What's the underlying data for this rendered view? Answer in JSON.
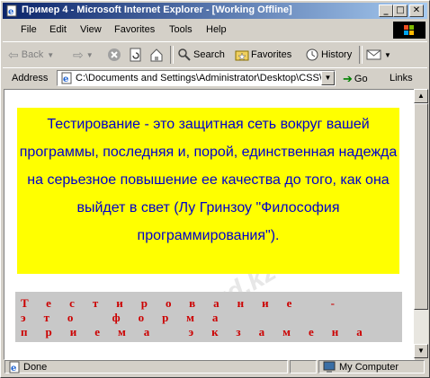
{
  "window": {
    "title": "Пример 4 - Microsoft Internet Explorer - [Working Offline]"
  },
  "menu": {
    "items": [
      "File",
      "Edit",
      "View",
      "Favorites",
      "Tools",
      "Help"
    ]
  },
  "toolbar": {
    "back": "Back",
    "search": "Search",
    "favorites": "Favorites",
    "history": "History"
  },
  "address": {
    "label": "Address",
    "value": "C:\\Documents and Settings\\Administrator\\Desktop\\CSS\\У",
    "go": "Go",
    "links": "Links"
  },
  "content": {
    "paragraph1": "Тестирование - это защитная сеть вокруг вашей программы, последняя и, порой, единственная надежда на серьезное повышение ее качества до того, как она выйдет в свет (Лу Гринзоу \"Философия программирования\").",
    "paragraph2": "Тестирование - это форма приема экзамена",
    "colors": {
      "para1_bg": "#ffff00",
      "para1_text": "#0000cc",
      "para2_bg": "#c8c8c8",
      "para2_text": "#cc0000"
    }
  },
  "status": {
    "text": "Done",
    "zone": "My Computer"
  },
  "watermark": {
    "text": "Stud.kz"
  }
}
